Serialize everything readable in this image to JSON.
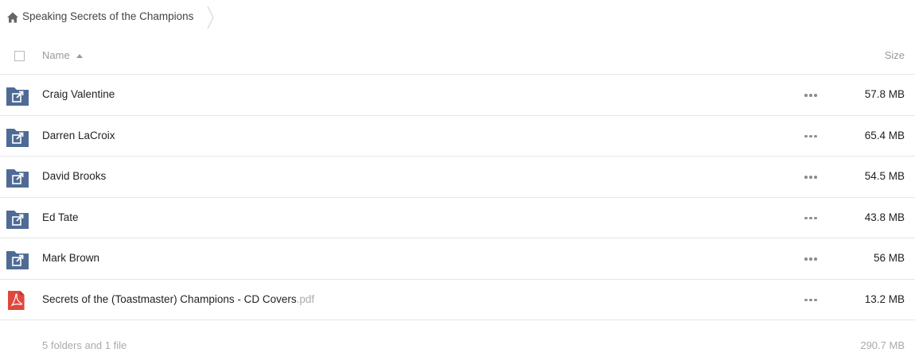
{
  "breadcrumb": {
    "home_icon": "home-icon",
    "current": "Speaking Secrets of the Champions"
  },
  "header": {
    "name_label": "Name",
    "size_label": "Size",
    "sort_icon": "sort-ascending-icon"
  },
  "rows": [
    {
      "type": "shared-folder",
      "icon": "shared-folder-icon",
      "name": "Craig Valentine",
      "ext": "",
      "size": "57.8 MB"
    },
    {
      "type": "shared-folder",
      "icon": "shared-folder-icon",
      "name": "Darren LaCroix",
      "ext": "",
      "size": "65.4 MB"
    },
    {
      "type": "shared-folder",
      "icon": "shared-folder-icon",
      "name": "David Brooks",
      "ext": "",
      "size": "54.5 MB"
    },
    {
      "type": "shared-folder",
      "icon": "shared-folder-icon",
      "name": "Ed Tate",
      "ext": "",
      "size": "43.8 MB"
    },
    {
      "type": "shared-folder",
      "icon": "shared-folder-icon",
      "name": "Mark Brown",
      "ext": "",
      "size": "56 MB"
    },
    {
      "type": "pdf",
      "icon": "pdf-file-icon",
      "name": "Secrets of the (Toastmaster) Champions - CD Covers",
      "ext": ".pdf",
      "size": "13.2 MB"
    }
  ],
  "footer": {
    "summary": "5 folders and 1 file",
    "total": "290.7 MB"
  },
  "colors": {
    "folder": "#4f6b95",
    "pdf": "#e0473d",
    "divider": "#e6e6e6",
    "muted_text": "#aaaaaa"
  }
}
